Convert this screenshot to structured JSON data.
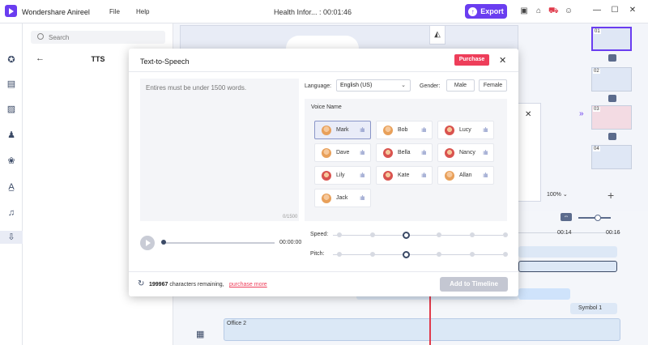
{
  "app": {
    "name": "Wondershare Anireel",
    "doc_title": "Health Infor... : 00:01:46"
  },
  "menu": {
    "file": "File",
    "help": "Help"
  },
  "toolbar": {
    "export_label": "Export"
  },
  "panel": {
    "search_placeholder": "Search",
    "title": "TTS"
  },
  "preview": {
    "zoom": "100%"
  },
  "timeline": {
    "ruler_0014": "00:14",
    "ruler_0016": "00:16",
    "symbol_label": "Symbol 1",
    "office_label": "Office 2"
  },
  "scenes": {
    "nums": [
      "01",
      "02",
      "03",
      "04"
    ]
  },
  "tts": {
    "title": "Text-to-Speech",
    "purchase_label": "Purchase",
    "text_placeholder": "Entires must be under 1500 words.",
    "char_count": "0/1500",
    "language_label": "Language:",
    "language_value": "English (US)",
    "gender_label": "Gender:",
    "gender_male": "Male",
    "gender_female": "Female",
    "voice_name_header": "Voice Name",
    "voices": [
      {
        "name": "Mark",
        "gender": "m"
      },
      {
        "name": "Bob",
        "gender": "m"
      },
      {
        "name": "Lucy",
        "gender": "f"
      },
      {
        "name": "Dave",
        "gender": "m"
      },
      {
        "name": "Bella",
        "gender": "f"
      },
      {
        "name": "Nancy",
        "gender": "f"
      },
      {
        "name": "Lily",
        "gender": "f"
      },
      {
        "name": "Kate",
        "gender": "f"
      },
      {
        "name": "Allan",
        "gender": "m"
      },
      {
        "name": "Jack",
        "gender": "m"
      }
    ],
    "selected_voice": "Mark",
    "time": "00:00:00",
    "speed_label": "Speed:",
    "pitch_label": "Pitch:",
    "speed_level": 0.43,
    "pitch_level": 0.43,
    "remaining_count": "199967",
    "remaining_text": "characters remaining,",
    "purchase_more": "purchase more",
    "add_to_timeline": "Add to Timeline"
  },
  "colors": {
    "accent": "#6a3df0",
    "purchase": "#ee3e5a",
    "playhead": "#e03a4b"
  }
}
